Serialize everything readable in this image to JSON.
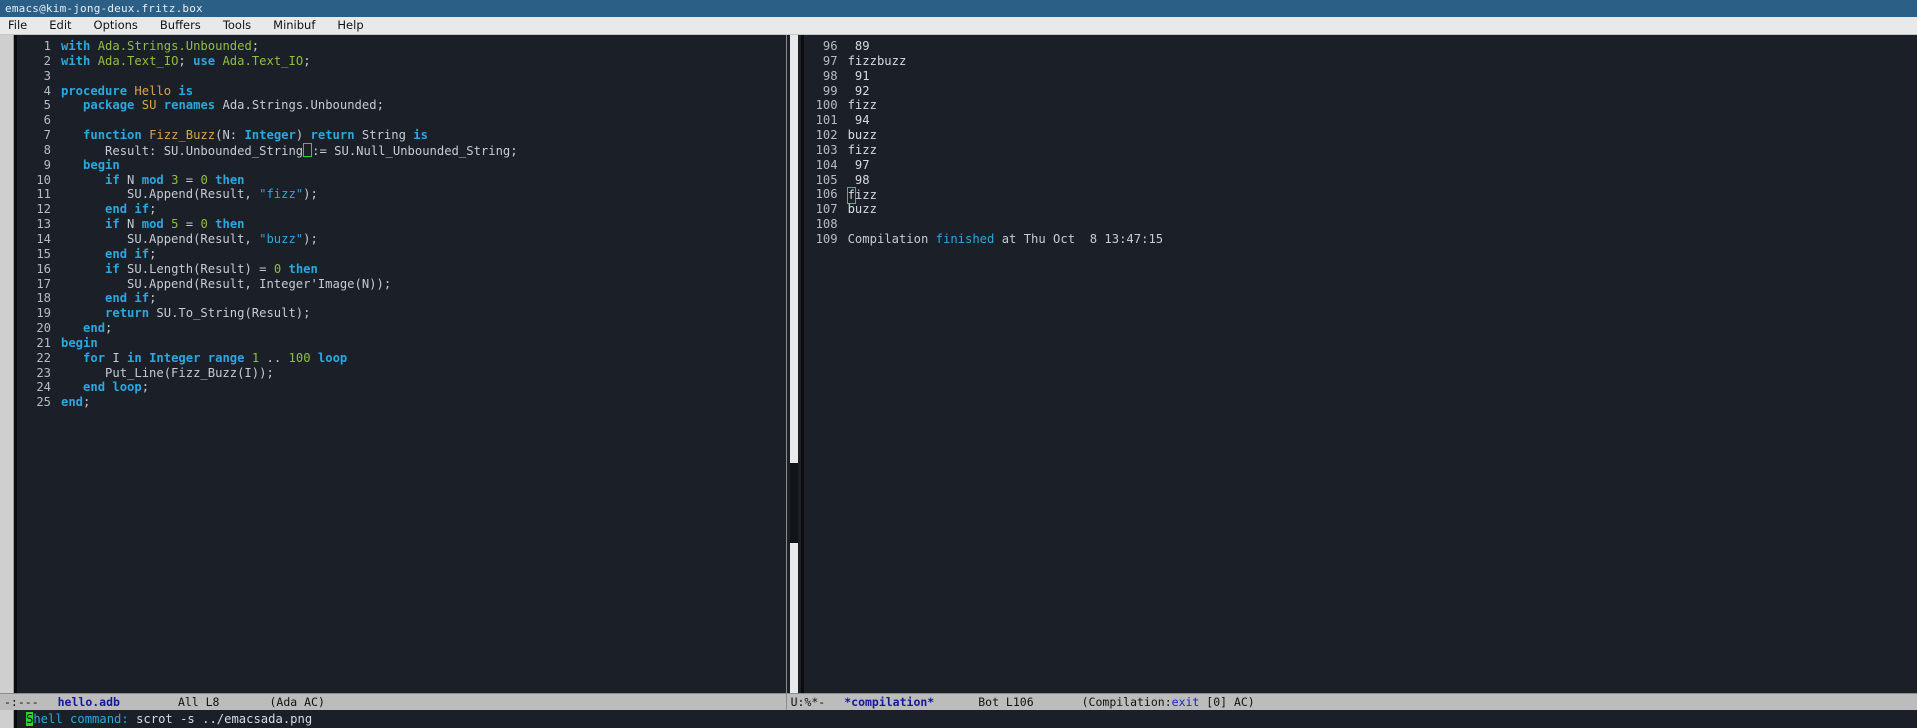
{
  "window": {
    "title": "emacs@kim-jong-deux.fritz.box"
  },
  "menubar": {
    "items": [
      "File",
      "Edit",
      "Options",
      "Buffers",
      "Tools",
      "Minibuf",
      "Help"
    ]
  },
  "colors": {
    "titlebar_bg": "#2b5f85",
    "menubar_bg": "#e9e9e9",
    "editor_bg": "#1b1f27",
    "modeline_bg": "#bcbcbc",
    "keyword": "#2aa8e0",
    "function_name": "#d8a64a",
    "number": "#8fbf3f",
    "package": "#8fbf3f",
    "cursor": "#27d927",
    "buffer_name": "#14189c"
  },
  "left_window": {
    "buffer_name": "hello.adb",
    "lines": [
      {
        "n": "1",
        "tokens": [
          {
            "t": "with",
            "c": "kw"
          },
          {
            "t": " ",
            "c": "plain"
          },
          {
            "t": "Ada.Strings.Unbounded",
            "c": "pkg"
          },
          {
            "t": ";",
            "c": "plain"
          }
        ]
      },
      {
        "n": "2",
        "tokens": [
          {
            "t": "with",
            "c": "kw"
          },
          {
            "t": " ",
            "c": "plain"
          },
          {
            "t": "Ada.Text_IO",
            "c": "pkg"
          },
          {
            "t": "; ",
            "c": "plain"
          },
          {
            "t": "use",
            "c": "kw"
          },
          {
            "t": " ",
            "c": "plain"
          },
          {
            "t": "Ada.Text_IO",
            "c": "pkg"
          },
          {
            "t": ";",
            "c": "plain"
          }
        ]
      },
      {
        "n": "3",
        "tokens": []
      },
      {
        "n": "4",
        "tokens": [
          {
            "t": "procedure",
            "c": "kw"
          },
          {
            "t": " ",
            "c": "plain"
          },
          {
            "t": "Hello",
            "c": "fn"
          },
          {
            "t": " ",
            "c": "plain"
          },
          {
            "t": "is",
            "c": "kw"
          }
        ]
      },
      {
        "n": "5",
        "tokens": [
          {
            "t": "   ",
            "c": "plain"
          },
          {
            "t": "package",
            "c": "kw"
          },
          {
            "t": " ",
            "c": "plain"
          },
          {
            "t": "SU",
            "c": "fn"
          },
          {
            "t": " ",
            "c": "plain"
          },
          {
            "t": "renames",
            "c": "kw"
          },
          {
            "t": " ",
            "c": "plain"
          },
          {
            "t": "Ada.Strings.Unbounded",
            "c": "plain"
          },
          {
            "t": ";",
            "c": "plain"
          }
        ]
      },
      {
        "n": "6",
        "tokens": []
      },
      {
        "n": "7",
        "tokens": [
          {
            "t": "   ",
            "c": "plain"
          },
          {
            "t": "function",
            "c": "kw"
          },
          {
            "t": " ",
            "c": "plain"
          },
          {
            "t": "Fizz_Buzz",
            "c": "fn"
          },
          {
            "t": "(N: ",
            "c": "plain"
          },
          {
            "t": "Integer",
            "c": "kw"
          },
          {
            "t": ") ",
            "c": "plain"
          },
          {
            "t": "return",
            "c": "kw"
          },
          {
            "t": " ",
            "c": "plain"
          },
          {
            "t": "String",
            "c": "plain"
          },
          {
            "t": " ",
            "c": "plain"
          },
          {
            "t": "is",
            "c": "kw"
          }
        ]
      },
      {
        "n": "8",
        "tokens": [
          {
            "t": "      Result: SU.Unbounded_String",
            "c": "plain"
          },
          {
            "t": " ",
            "c": "cursor-empty"
          },
          {
            "t": ":= SU.Null_Unbounded_String;",
            "c": "plain"
          }
        ]
      },
      {
        "n": "9",
        "tokens": [
          {
            "t": "   ",
            "c": "plain"
          },
          {
            "t": "begin",
            "c": "kw"
          }
        ]
      },
      {
        "n": "10",
        "tokens": [
          {
            "t": "      ",
            "c": "plain"
          },
          {
            "t": "if",
            "c": "kw"
          },
          {
            "t": " N ",
            "c": "plain"
          },
          {
            "t": "mod",
            "c": "kw"
          },
          {
            "t": " ",
            "c": "plain"
          },
          {
            "t": "3",
            "c": "num"
          },
          {
            "t": " = ",
            "c": "plain"
          },
          {
            "t": "0",
            "c": "num"
          },
          {
            "t": " ",
            "c": "plain"
          },
          {
            "t": "then",
            "c": "kw"
          }
        ]
      },
      {
        "n": "11",
        "tokens": [
          {
            "t": "         SU.Append(Result, ",
            "c": "plain"
          },
          {
            "t": "\"fizz\"",
            "c": "str"
          },
          {
            "t": ");",
            "c": "plain"
          }
        ]
      },
      {
        "n": "12",
        "tokens": [
          {
            "t": "      ",
            "c": "plain"
          },
          {
            "t": "end if",
            "c": "kw"
          },
          {
            "t": ";",
            "c": "plain"
          }
        ]
      },
      {
        "n": "13",
        "tokens": [
          {
            "t": "      ",
            "c": "plain"
          },
          {
            "t": "if",
            "c": "kw"
          },
          {
            "t": " N ",
            "c": "plain"
          },
          {
            "t": "mod",
            "c": "kw"
          },
          {
            "t": " ",
            "c": "plain"
          },
          {
            "t": "5",
            "c": "num"
          },
          {
            "t": " = ",
            "c": "plain"
          },
          {
            "t": "0",
            "c": "num"
          },
          {
            "t": " ",
            "c": "plain"
          },
          {
            "t": "then",
            "c": "kw"
          }
        ]
      },
      {
        "n": "14",
        "tokens": [
          {
            "t": "         SU.Append(Result, ",
            "c": "plain"
          },
          {
            "t": "\"buzz\"",
            "c": "str"
          },
          {
            "t": ");",
            "c": "plain"
          }
        ]
      },
      {
        "n": "15",
        "tokens": [
          {
            "t": "      ",
            "c": "plain"
          },
          {
            "t": "end if",
            "c": "kw"
          },
          {
            "t": ";",
            "c": "plain"
          }
        ]
      },
      {
        "n": "16",
        "tokens": [
          {
            "t": "      ",
            "c": "plain"
          },
          {
            "t": "if",
            "c": "kw"
          },
          {
            "t": " SU.Length(Result) = ",
            "c": "plain"
          },
          {
            "t": "0",
            "c": "num"
          },
          {
            "t": " ",
            "c": "plain"
          },
          {
            "t": "then",
            "c": "kw"
          }
        ]
      },
      {
        "n": "17",
        "tokens": [
          {
            "t": "         SU.Append(Result, Integer'Image(N));",
            "c": "plain"
          }
        ]
      },
      {
        "n": "18",
        "tokens": [
          {
            "t": "      ",
            "c": "plain"
          },
          {
            "t": "end if",
            "c": "kw"
          },
          {
            "t": ";",
            "c": "plain"
          }
        ]
      },
      {
        "n": "19",
        "tokens": [
          {
            "t": "      ",
            "c": "plain"
          },
          {
            "t": "return",
            "c": "kw"
          },
          {
            "t": " SU.To_String(Result);",
            "c": "plain"
          }
        ]
      },
      {
        "n": "20",
        "tokens": [
          {
            "t": "   ",
            "c": "plain"
          },
          {
            "t": "end",
            "c": "kw"
          },
          {
            "t": ";",
            "c": "plain"
          }
        ]
      },
      {
        "n": "21",
        "tokens": [
          {
            "t": "begin",
            "c": "kw"
          }
        ]
      },
      {
        "n": "22",
        "tokens": [
          {
            "t": "   ",
            "c": "plain"
          },
          {
            "t": "for",
            "c": "kw"
          },
          {
            "t": " I ",
            "c": "plain"
          },
          {
            "t": "in",
            "c": "kw"
          },
          {
            "t": " ",
            "c": "plain"
          },
          {
            "t": "Integer",
            "c": "kw"
          },
          {
            "t": " ",
            "c": "plain"
          },
          {
            "t": "range",
            "c": "kw"
          },
          {
            "t": " ",
            "c": "plain"
          },
          {
            "t": "1",
            "c": "num"
          },
          {
            "t": " .. ",
            "c": "plain"
          },
          {
            "t": "100",
            "c": "num"
          },
          {
            "t": " ",
            "c": "plain"
          },
          {
            "t": "loop",
            "c": "kw"
          }
        ]
      },
      {
        "n": "23",
        "tokens": [
          {
            "t": "      Put_Line(Fizz_Buzz(I));",
            "c": "plain"
          }
        ]
      },
      {
        "n": "24",
        "tokens": [
          {
            "t": "   ",
            "c": "plain"
          },
          {
            "t": "end loop",
            "c": "kw"
          },
          {
            "t": ";",
            "c": "plain"
          }
        ]
      },
      {
        "n": "25",
        "tokens": [
          {
            "t": "end",
            "c": "kw"
          },
          {
            "t": ";",
            "c": "plain"
          }
        ]
      }
    ],
    "modeline": {
      "flags": "-:---",
      "buffer": "hello.adb",
      "position": "All L8",
      "mode": "(Ada AC)"
    }
  },
  "right_window": {
    "buffer_name": "*compilation*",
    "lines": [
      {
        "n": "96",
        "text": " 89"
      },
      {
        "n": "97",
        "text": "fizzbuzz"
      },
      {
        "n": "98",
        "text": " 91"
      },
      {
        "n": "99",
        "text": " 92"
      },
      {
        "n": "100",
        "text": "fizz"
      },
      {
        "n": "101",
        "text": " 94"
      },
      {
        "n": "102",
        "text": "buzz"
      },
      {
        "n": "103",
        "text": "fizz"
      },
      {
        "n": "104",
        "text": " 97"
      },
      {
        "n": "105",
        "text": " 98"
      },
      {
        "n": "106",
        "text": "fizz",
        "cursor_at": 0
      },
      {
        "n": "107",
        "text": "buzz"
      },
      {
        "n": "108",
        "text": ""
      },
      {
        "n": "109",
        "text": "Compilation finished at Thu Oct  8 13:47:15",
        "parts": [
          {
            "t": "Compilation ",
            "c": "plain"
          },
          {
            "t": "finished",
            "c": "cmpkw"
          },
          {
            "t": " at Thu Oct  8 13:47:15",
            "c": "plain"
          }
        ]
      }
    ],
    "modeline": {
      "flags": "U:%*-",
      "buffer": "*compilation*",
      "position": "Bot L106",
      "mode_prefix": "(Compilation:",
      "mode_link": "exit",
      "mode_suffix": " [0] AC)"
    }
  },
  "minibuffer": {
    "prompt": "Shell command:",
    "cursor_char": "S",
    "prompt_rest": "hell command:",
    "value": " scrot -s ../emacsada.png"
  }
}
